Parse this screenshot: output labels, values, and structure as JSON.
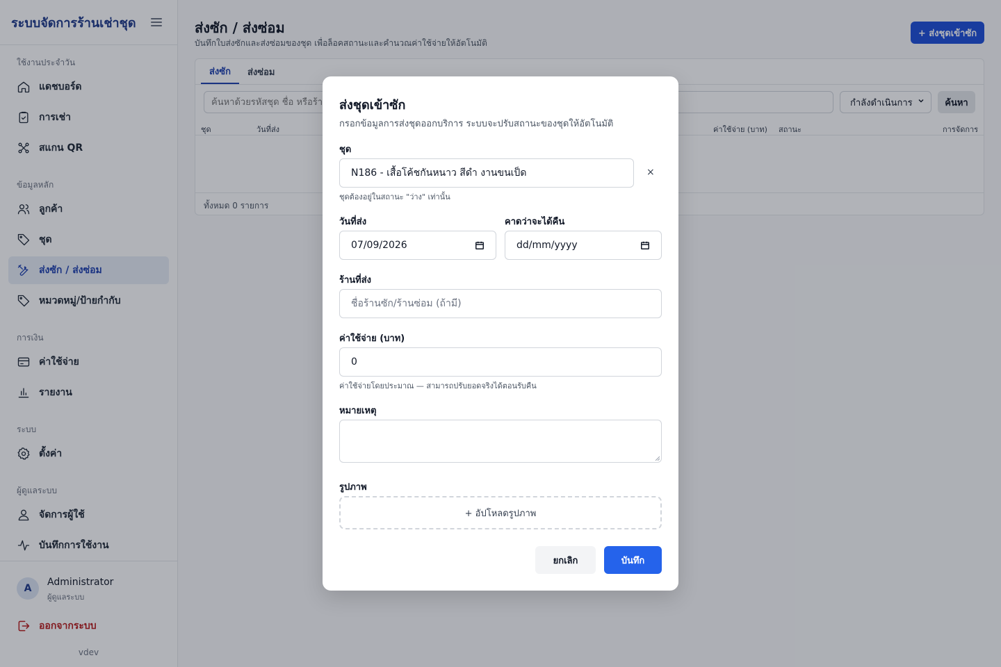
{
  "sidebar": {
    "brand": "ระบบจัดการร้านเช่าชุด",
    "sections": {
      "daily": "ใช้งานประจำวัน",
      "master": "ข้อมูลหลัก",
      "finance": "การเงิน",
      "system": "ระบบ",
      "admin": "ผู้ดูแลระบบ"
    },
    "items": {
      "dashboard": "แดชบอร์ด",
      "rentals": "การเช่า",
      "scan_qr": "สแกน QR",
      "customers": "ลูกค้า",
      "outfits": "ชุด",
      "laundry_repair": "ส่งซัก / ส่งซ่อม",
      "categories": "หมวดหมู่/ป้ายกำกับ",
      "expenses": "ค่าใช้จ่าย",
      "reports": "รายงาน",
      "settings": "ตั้งค่า",
      "users": "จัดการผู้ใช้",
      "activity_log": "บันทึกการใช้งาน"
    },
    "user": {
      "initial": "A",
      "name": "Administrator",
      "role": "ผู้ดูแลระบบ"
    },
    "logout": "ออกจากระบบ",
    "version": "vdev"
  },
  "main": {
    "title": "ส่งซัก / ส่งซ่อม",
    "subtitle": "บันทึกใบส่งซักและส่งซ่อมของชุด เพื่อล็อคสถานะและคำนวณค่าใช้จ่ายให้อัตโนมัติ",
    "add_button": "+ ส่งชุดเข้าซัก",
    "tabs": [
      "ส่งซัก",
      "ส่งซ่อม"
    ],
    "search_placeholder": "ค้นหาด้วยรหัสชุด ชื่อ หรือร้าน",
    "status_filter": "กำลังดำเนินการ",
    "search_button": "ค้นหา",
    "columns": [
      "ชุด",
      "วันที่ส่ง",
      "ค่าใช้จ่าย (บาท)",
      "สถานะ",
      "การจัดการ"
    ],
    "total_text": "ทั้งหมด 0 รายการ"
  },
  "modal": {
    "title": "ส่งชุดเข้าซัก",
    "description": "กรอกข้อมูลการส่งชุดออกบริการ ระบบจะปรับสถานะของชุดให้อัตโนมัติ",
    "outfit_label": "ชุด",
    "outfit_value": "N186 - เสื้อโค้ชกันหนาว สีดำ งานขนเป็ด",
    "clear_symbol": "×",
    "outfit_hint": "ชุดต้องอยู่ในสถานะ \"ว่าง\" เท่านั้น",
    "send_date_label": "วันที่ส่ง",
    "send_date_value": "07/09/2026",
    "return_date_label": "คาดว่าจะได้คืน",
    "return_date_placeholder": "dd/mm/yyyy",
    "shop_label": "ร้านที่ส่ง",
    "shop_placeholder": "ชื่อร้านซัก/ร้านซ่อม (ถ้ามี)",
    "cost_label": "ค่าใช้จ่าย (บาท)",
    "cost_value": "0",
    "cost_hint": "ค่าใช้จ่ายโดยประมาณ — สามารถปรับยอดจริงได้ตอนรับคืน",
    "note_label": "หมายเหตุ",
    "image_label": "รูปภาพ",
    "upload_label": "+ อัปโหลดรูปภาพ",
    "cancel": "ยกเลิก",
    "save": "บันทึก"
  }
}
